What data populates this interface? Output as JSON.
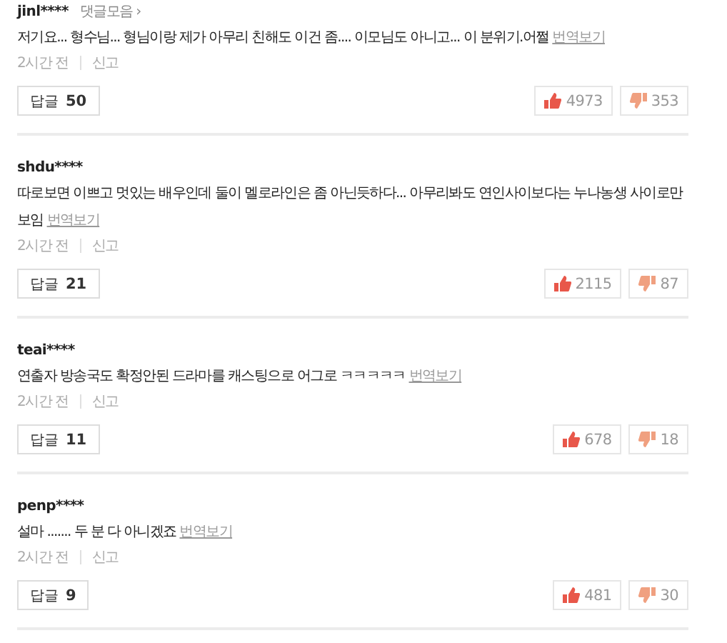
{
  "comments": [
    {
      "user": "jinl****",
      "collection_link": "댓글모음 ›",
      "text": "저기요... 형수님... 형님이랑 제가 아무리 친해도 이건 좀.... 이모님도 아니고... 이 분위기.어쩔",
      "translate": "번역보기",
      "time": "2시간 전",
      "report": "신고",
      "reply_label": "답글",
      "reply_count": "50",
      "likes": "4973",
      "dislikes": "353"
    },
    {
      "user": "shdu****",
      "text": "따로보면 이쁘고 멋있는 배우인데 둘이 멜로라인은 좀 아닌듯하다... 아무리봐도 연인사이보다는 누나농생 사이로만 보임",
      "translate": "번역보기",
      "time": "2시간 전",
      "report": "신고",
      "reply_label": "답글",
      "reply_count": "21",
      "likes": "2115",
      "dislikes": "87"
    },
    {
      "user": "teai****",
      "text": "연출자 방송국도 확정안된 드라마를 캐스팅으로 어그로 ㅋㅋㅋㅋㅋ",
      "translate": "번역보기",
      "time": "2시간 전",
      "report": "신고",
      "reply_label": "답글",
      "reply_count": "11",
      "likes": "678",
      "dislikes": "18"
    },
    {
      "user": "penp****",
      "text": "설마 ....... 두 분 다 아니겠죠",
      "translate": "번역보기",
      "time": "2시간 전",
      "report": "신고",
      "reply_label": "답글",
      "reply_count": "9",
      "likes": "481",
      "dislikes": "30"
    }
  ]
}
